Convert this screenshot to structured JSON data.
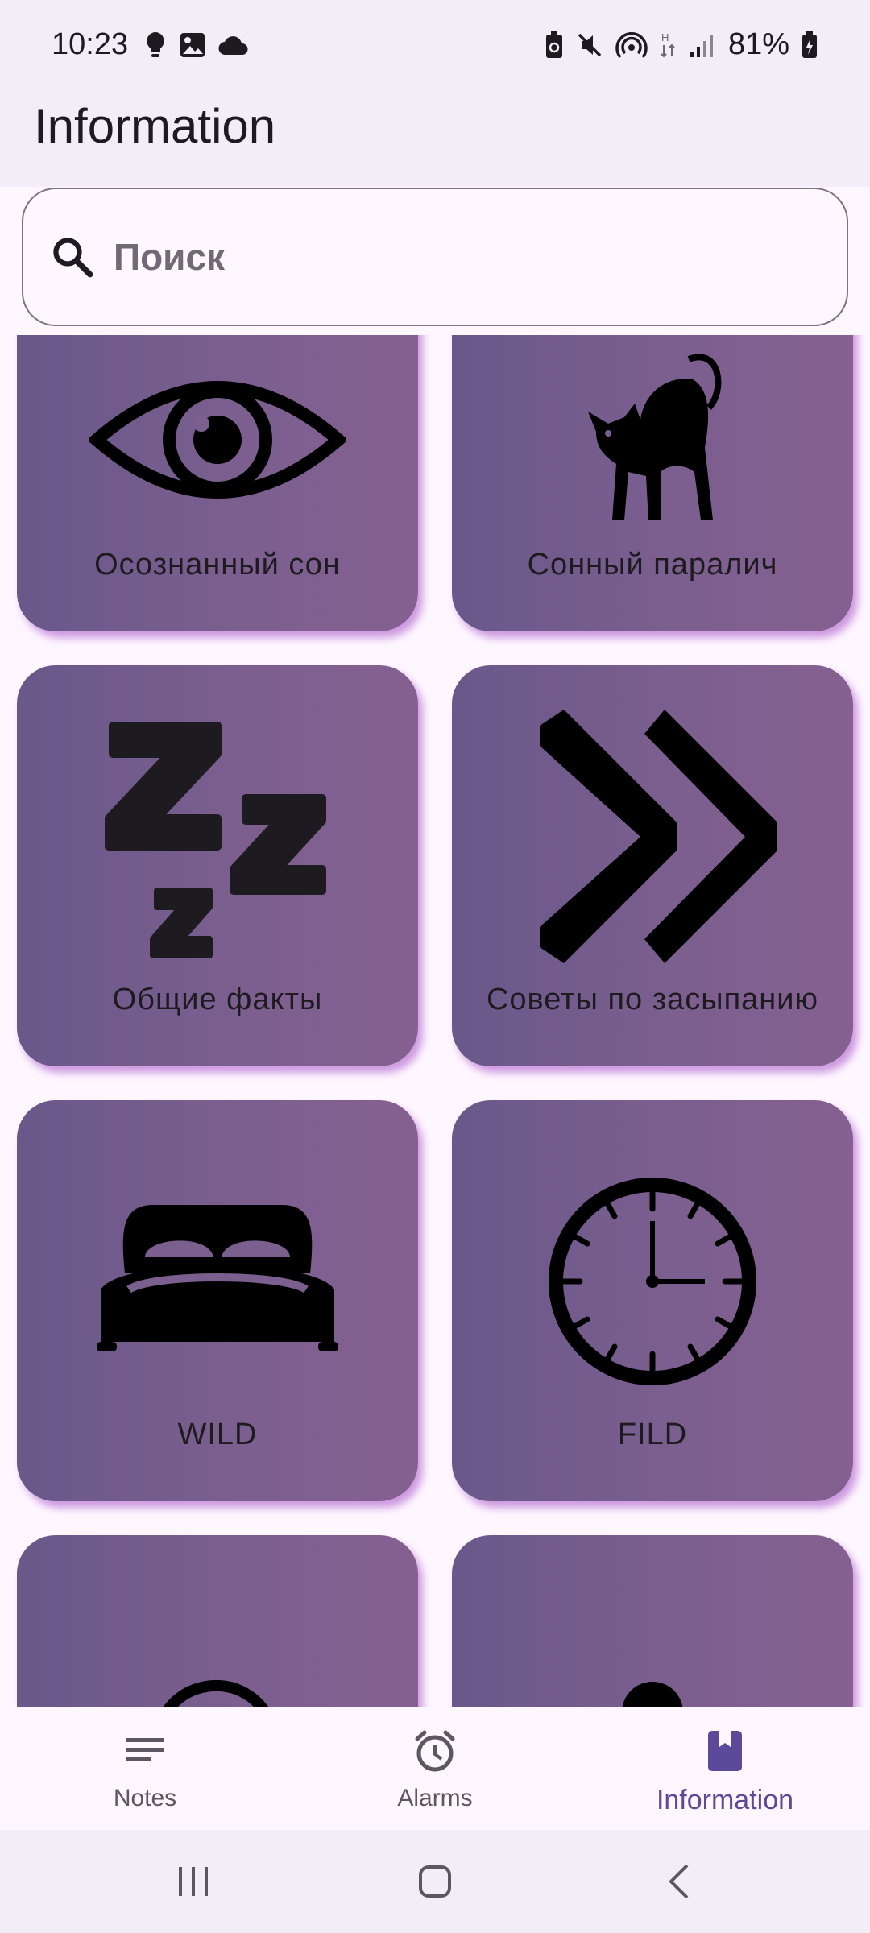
{
  "status_bar": {
    "time": "10:23",
    "battery_percent": "81%",
    "left_icons": [
      "lightbulb-icon",
      "image-icon",
      "cloud-icon"
    ],
    "right_icons": [
      "battery-saver-icon",
      "mute-icon",
      "hotspot-icon",
      "data-arrows-icon",
      "signal-icon",
      "battery-icon"
    ]
  },
  "app_bar": {
    "title": "Information"
  },
  "search": {
    "placeholder": "Поиск",
    "value": "",
    "icon": "search-icon"
  },
  "cards": [
    {
      "label": "Осознанный сон",
      "icon": "eye-icon"
    },
    {
      "label": "Сонный паралич",
      "icon": "cat-icon"
    },
    {
      "label": "Общие факты",
      "icon": "zzz-icon"
    },
    {
      "label": "Советы по засыпанию",
      "icon": "double-chevron-icon"
    },
    {
      "label": "WILD",
      "icon": "bed-icon"
    },
    {
      "label": "FILD",
      "icon": "clock-icon"
    },
    {
      "label": "",
      "icon": "ear-icon"
    },
    {
      "label": "",
      "icon": "person-icon"
    }
  ],
  "bottom_nav": {
    "items": [
      {
        "label": "Notes",
        "icon": "notes-icon"
      },
      {
        "label": "Alarms",
        "icon": "alarm-icon"
      },
      {
        "label": "Information",
        "icon": "book-icon"
      }
    ],
    "active": "Information"
  },
  "colors": {
    "accent": "#5b4a9a",
    "card_gradient_start": "#69588a",
    "card_gradient_end": "#856090",
    "card_shadow": "#bc78d6",
    "background": "#fef7ff",
    "app_bar": "#f3edf7"
  }
}
